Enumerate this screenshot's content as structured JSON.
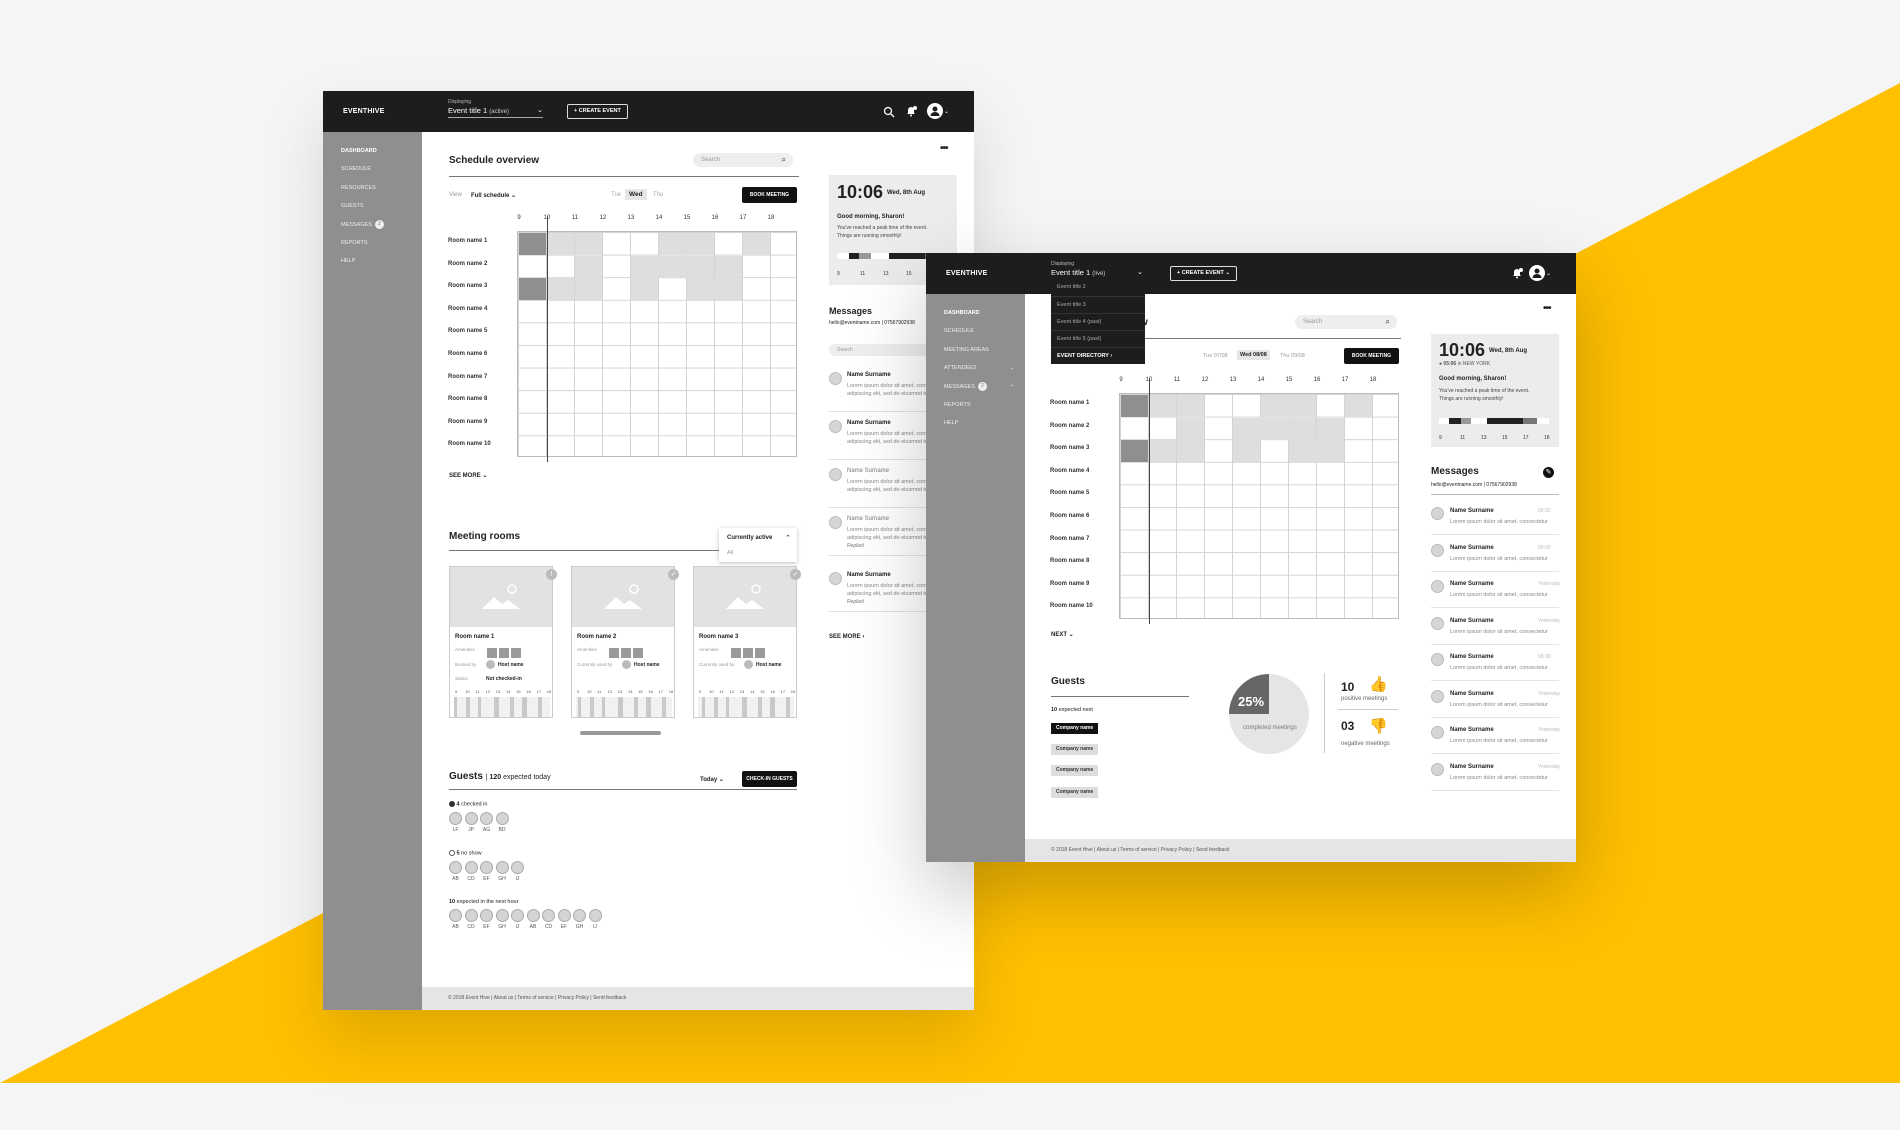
{
  "colors": {
    "yellow": "#FFC000",
    "dark": "#1d1d1d",
    "sidebar": "#8f8f8f",
    "background": "#f5f5f5"
  },
  "brand": "EVENTHIVE",
  "topbar": {
    "displaying_label": "Displaying",
    "event_title": "Event title 1",
    "event_state_1": "(active)",
    "event_state_2": "(live)",
    "create_event": "CREATE EVENT",
    "icons": [
      "search-icon",
      "notification-icon",
      "user-avatar-icon"
    ]
  },
  "sidebar1": {
    "items": [
      "DASHBOARD",
      "SCHEDULE",
      "RESOURCES",
      "GUESTS",
      "MESSAGES",
      "REPORTS",
      "HELP"
    ],
    "messages_badge": "2"
  },
  "sidebar2": {
    "items": [
      "DASHBOARD",
      "SCHEDULE",
      "MEETING AREAS",
      "ATTENDEES",
      "MESSAGES",
      "REPORTS",
      "HELP"
    ],
    "messages_badge": "2"
  },
  "more_menu": "•••",
  "schedule": {
    "title": "Schedule overview",
    "search_placeholder": "Search",
    "view_label": "View",
    "view_value": "Full schedule",
    "days": [
      "Tue",
      "Wed",
      "Thu"
    ],
    "book_meeting": "BOOK MEETING",
    "hours": [
      "9",
      "10",
      "11",
      "12",
      "13",
      "14",
      "15",
      "16",
      "17",
      "18"
    ],
    "rooms": [
      "Room name 1",
      "Room name 2",
      "Room name 3",
      "Room name 4",
      "Room name 5",
      "Room name 6",
      "Room name 7",
      "Room name 8",
      "Room name 9",
      "Room name 10"
    ],
    "see_more": "SEE MORE"
  },
  "schedule2": {
    "title_fragment": "w",
    "days": [
      "Tue 07/08",
      "Wed 08/08",
      "Thu 09/08"
    ],
    "next": "NEXT"
  },
  "clock": {
    "time": "10:06",
    "date": "Wed, 8th Aug",
    "greeting": "Good morning, Sharon!",
    "line1": "You've reached a peak time of the event.",
    "line2": "Things are running smoothly!",
    "hours": [
      "9",
      "11",
      "13",
      "15",
      "17"
    ],
    "hours2": [
      "9",
      "11",
      "13",
      "15",
      "17",
      "18"
    ],
    "local_time": "05:06",
    "local_city": "in NEW YORK"
  },
  "messages": {
    "title": "Messages",
    "email": "hello@eventname.com",
    "phone": "07567902938",
    "search_placeholder": "Search",
    "items": [
      {
        "name": "Name Surname",
        "text1": "Lorem ipsum dolor sit amet, consectetur",
        "text2": "adipiscing elit, sed do eiusmod tem",
        "replied": ""
      },
      {
        "name": "Name Surname",
        "text1": "Lorem ipsum dolor sit amet, consectetur",
        "text2": "adipiscing elit, sed do eiusmod tem",
        "replied": ""
      },
      {
        "name": "Name Surname",
        "text1": "Lorem ipsum dolor sit amet, consectetur",
        "text2": "adipiscing elit, sed do eiusmod tem",
        "replied": ""
      },
      {
        "name": "Name Surname",
        "text1": "Lorem ipsum dolor sit amet, consectetur",
        "text2": "adipiscing elit, sed do eiusmod tem",
        "replied": "Replied"
      },
      {
        "name": "Name Surname",
        "text1": "Lorem ipsum dolor sit amet, consectetur",
        "text2": "adipiscing elit, sed do eiusmod tem",
        "replied": "Replied"
      }
    ],
    "see_more": "SEE MORE",
    "snippet": "Lorem ipsum dolor sit amet, consectetur",
    "times": [
      "09:30",
      "09:00",
      "Yesterday",
      "Yesterday",
      "08:30",
      "Yesterday",
      "Yesterday",
      "Yesterday"
    ]
  },
  "meeting_rooms": {
    "title": "Meeting rooms",
    "filter_value": "Currently active",
    "filter_option": "All",
    "amenities": "Amenities",
    "booked_by": "Booked by",
    "currently_used_by": "Currently used by",
    "status": "Status",
    "status_value": "Not checked-in",
    "host": "Host name",
    "rooms": [
      "Room name 1",
      "Room name 2",
      "Room name 3"
    ],
    "hours": [
      "9",
      "10",
      "11",
      "12",
      "13",
      "14",
      "15",
      "16",
      "17",
      "18"
    ]
  },
  "guests": {
    "title": "Guests",
    "expected_count": "120",
    "expected_label": "expected today",
    "period": "Today",
    "checkin": "CHECK-IN GUESTS",
    "checked_in_count": "4",
    "checked_in_label": "checked in",
    "checked_in": [
      "LF",
      "JP",
      "AG",
      "BD"
    ],
    "no_show_count": "5",
    "no_show_label": "no show",
    "no_show": [
      "AB",
      "CD",
      "EF",
      "GH",
      "IJ"
    ],
    "next_hour_count": "10",
    "next_hour_label": "expected in the next hour",
    "next_hour": [
      "AB",
      "CD",
      "EF",
      "GH",
      "IJ",
      "AB",
      "CD",
      "EF",
      "GH",
      "IJ"
    ]
  },
  "guests2": {
    "title": "Guests",
    "expected_count": "10",
    "expected_label": "expected next",
    "companies": [
      "Company name",
      "Company name",
      "Company name",
      "Company name"
    ],
    "percent": "25%",
    "percent_label": "completed meetings",
    "positive_count": "10",
    "positive_label": "positive meetings",
    "negative_count": "03",
    "negative_label": "negative meetings"
  },
  "dropdown": {
    "items": [
      "Event title 2",
      "Event title 3",
      "Event title 4 (past)",
      "Event title 5 (past)"
    ],
    "directory": "EVENT DIRECTORY"
  },
  "footer": "© 2018 Event Hive | About us | Terms of service | Privacy Policy | Send feedback"
}
